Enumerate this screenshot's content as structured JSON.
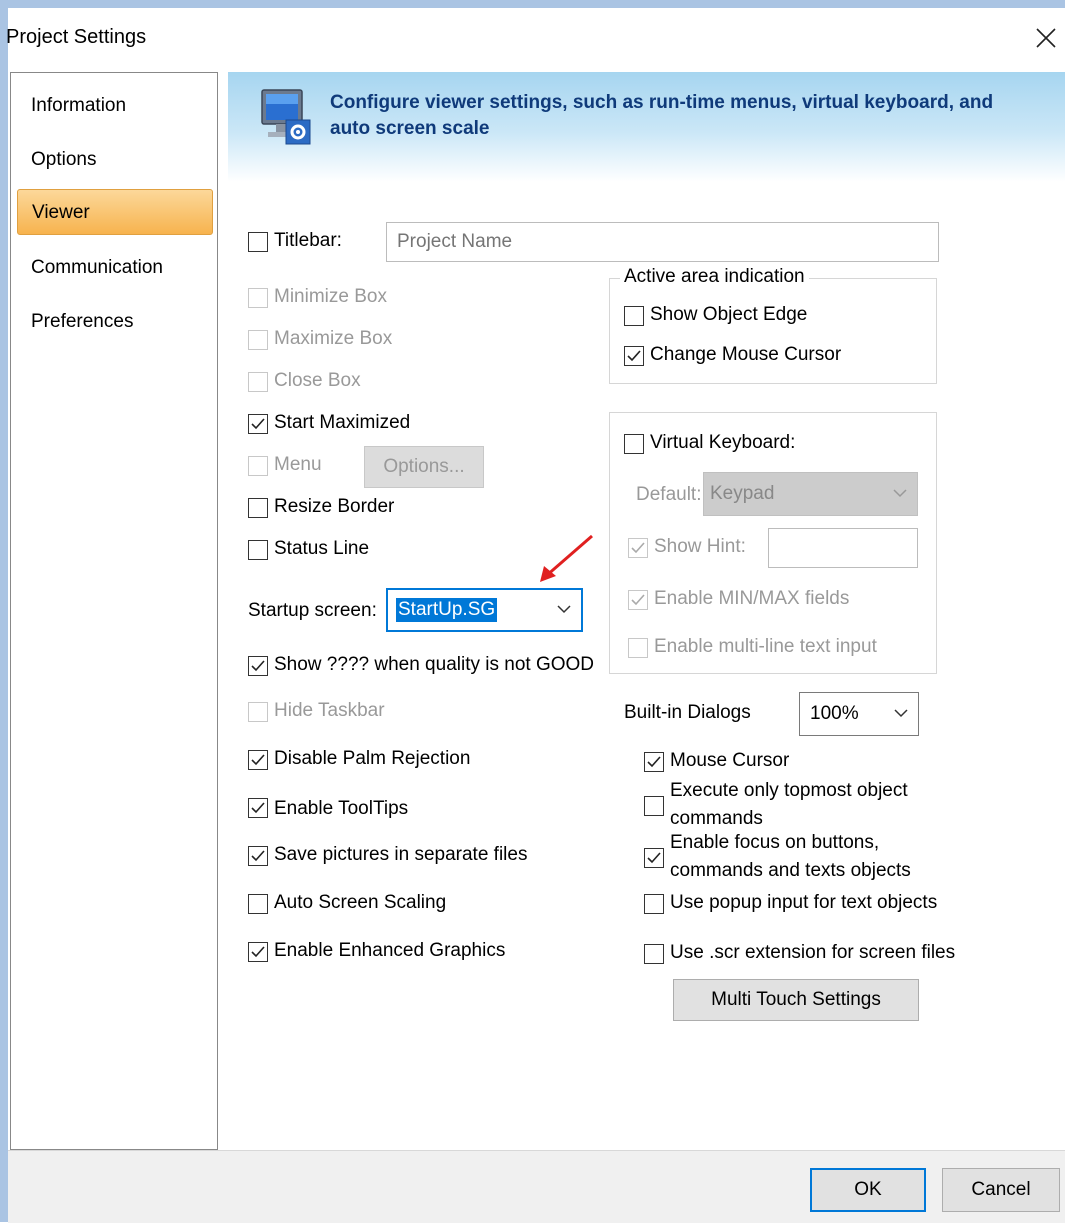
{
  "window": {
    "title": "Project Settings",
    "close_label": "X"
  },
  "nav": {
    "items": [
      {
        "label": "Information"
      },
      {
        "label": "Options"
      },
      {
        "label": "Viewer",
        "selected": true
      },
      {
        "label": "Communication"
      },
      {
        "label": "Preferences"
      }
    ]
  },
  "banner": {
    "text": "Configure viewer settings, such as run-time menus, virtual keyboard, and auto screen scale",
    "icon": "monitor-settings-icon"
  },
  "left": {
    "titlebar": {
      "label": "Titlebar:",
      "checked": false,
      "placeholder": "Project Name"
    },
    "minimize_box": {
      "label": "Minimize Box",
      "checked": false,
      "disabled": true
    },
    "maximize_box": {
      "label": "Maximize Box",
      "checked": false,
      "disabled": true
    },
    "close_box": {
      "label": "Close Box",
      "checked": false,
      "disabled": true
    },
    "start_maximized": {
      "label": "Start Maximized",
      "checked": true
    },
    "menu": {
      "label": "Menu",
      "checked": false,
      "disabled": true
    },
    "options_button": "Options...",
    "resize_border": {
      "label": "Resize Border",
      "checked": false
    },
    "status_line": {
      "label": "Status Line",
      "checked": false
    },
    "startup_screen": {
      "label": "Startup screen:",
      "value": "StartUp.SG"
    },
    "show_quality": {
      "label": "Show ???? when quality is not GOOD",
      "checked": true
    },
    "hide_taskbar": {
      "label": "Hide Taskbar",
      "checked": false,
      "disabled": true
    },
    "palm_rejection": {
      "label": "Disable Palm Rejection",
      "checked": true
    },
    "tooltips": {
      "label": "Enable ToolTips",
      "checked": true
    },
    "save_pictures": {
      "label": "Save pictures in separate files",
      "checked": true
    },
    "auto_scaling": {
      "label": "Auto Screen Scaling",
      "checked": false
    },
    "enhanced_graphics": {
      "label": "Enable Enhanced Graphics",
      "checked": true
    }
  },
  "right": {
    "active_area": {
      "title": "Active area indication",
      "show_edge": {
        "label": "Show Object Edge",
        "checked": false
      },
      "mouse_cursor": {
        "label": "Change Mouse Cursor",
        "checked": true
      }
    },
    "virtual_keyboard": {
      "label": "Virtual Keyboard:",
      "checked": false,
      "default_label": "Default:",
      "default_value": "Keypad",
      "show_hint": {
        "label": "Show Hint:",
        "checked": true,
        "disabled": true
      },
      "min_max": {
        "label": "Enable MIN/MAX fields",
        "checked": true,
        "disabled": true
      },
      "multiline": {
        "label": "Enable multi-line text input",
        "checked": false,
        "disabled": true
      }
    },
    "builtin_dialogs": {
      "label": "Built-in Dialogs",
      "value": "100%"
    },
    "mouse_cursor": {
      "label": "Mouse Cursor",
      "checked": true
    },
    "topmost": {
      "label_line1": "Execute only topmost object",
      "label_line2": "commands",
      "checked": false
    },
    "focus": {
      "label_line1": "Enable focus on buttons,",
      "label_line2": "commands and texts objects",
      "checked": true
    },
    "popup_input": {
      "label": "Use popup input for text objects",
      "checked": false
    },
    "scr_extension": {
      "label": "Use .scr extension for screen files",
      "checked": false
    },
    "multi_touch_button": "Multi Touch Settings"
  },
  "footer": {
    "ok": "OK",
    "cancel": "Cancel"
  },
  "colors": {
    "selected_nav": "#f7b34e",
    "accent": "#0078d7",
    "banner_text": "#0f3a7a",
    "arrow": "#e02020"
  }
}
